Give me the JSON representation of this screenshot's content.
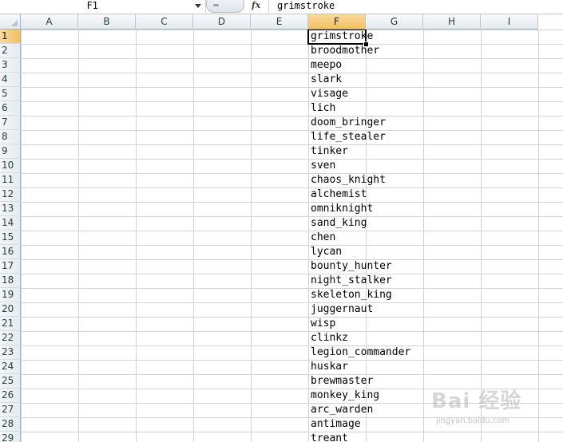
{
  "formula_bar": {
    "name_box": "F1",
    "formula": "grimstroke"
  },
  "columns": [
    "A",
    "B",
    "C",
    "D",
    "E",
    "F",
    "G",
    "H",
    "I"
  ],
  "selected_column": "F",
  "rows": [
    "1",
    "2",
    "3",
    "4",
    "5",
    "6",
    "7",
    "8",
    "9",
    "10",
    "11",
    "12",
    "13",
    "14",
    "15",
    "16",
    "17",
    "18",
    "19",
    "20",
    "21",
    "22",
    "23",
    "24",
    "25",
    "26",
    "27",
    "28",
    "29"
  ],
  "selected_row": "1",
  "column_f_values": [
    "grimstroke",
    "broodmother",
    "meepo",
    "slark",
    "visage",
    "lich",
    "doom_bringer",
    "life_stealer",
    "tinker",
    "sven",
    "chaos_knight",
    "alchemist",
    "omniknight",
    "sand_king",
    "chen",
    "lycan",
    "bounty_hunter",
    "night_stalker",
    "skeleton_king",
    "juggernaut",
    "wisp",
    "clinkz",
    "legion_commander",
    "huskar",
    "brewmaster",
    "monkey_king",
    "arc_warden",
    "antimage",
    "treant"
  ],
  "watermark": {
    "logo": "Bai 经验",
    "url": "jingyan.baidu.com"
  },
  "colors": {
    "selected_header": "#f1c15f",
    "header": "#e4e9f0",
    "gridline": "#d4d4d4"
  }
}
